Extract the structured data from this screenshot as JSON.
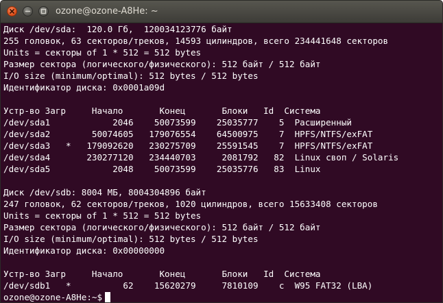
{
  "window": {
    "title": "ozone@ozone-A8He: ~"
  },
  "icons": {
    "close": "close-icon",
    "minimize": "minimize-icon",
    "maximize": "maximize-icon"
  },
  "colors": {
    "terminal_background": "#300a24",
    "terminal_text": "#ffffff",
    "titlebar": "#4a4943",
    "close_button": "#e1531d"
  },
  "terminal": {
    "lines": [
      "Диск /dev/sda:  120.0 Гб,  120034123776 байт",
      "255 головок, 63 секторов/треков, 14593 цилиндров, всего 234441648 секторов",
      "Units = секторы of 1 * 512 = 512 bytes",
      "Размер сектора (логического/физического): 512 байт / 512 байт",
      "I/O size (minimum/optimal): 512 bytes / 512 bytes",
      "Идентификатор диска: 0x0001a09d",
      "",
      "Устр-во Загр     Начало       Конец       Блоки   Id  Система",
      "/dev/sda1            2046    50073599    25035777    5  Расширенный",
      "/dev/sda2        50074605   179076554    64500975    7  HPFS/NTFS/exFAT",
      "/dev/sda3   *   179092620   230275709    25591545    7  HPFS/NTFS/exFAT",
      "/dev/sda4       230277120   234440703     2081792   82  Linux своп / Solaris",
      "/dev/sda5            2048    50073599    25035776   83  Linux",
      "",
      "Диск /dev/sdb: 8004 МБ, 8004304896 байт",
      "247 головок, 62 секторов/треков, 1020 цилиндров, всего 15633408 секторов",
      "Units = секторы of 1 * 512 = 512 bytes",
      "Размер сектора (логического/физического): 512 байт / 512 байт",
      "I/O size (minimum/optimal): 512 bytes / 512 bytes",
      "Идентификатор диска: 0x00000000",
      "",
      "Устр-во Загр     Начало       Конец       Блоки   Id  Система",
      "/dev/sdb1   *          62    15620279     7810109    c  W95 FAT32 (LBA)"
    ],
    "prompt": "ozone@ozone-A8He:~$"
  }
}
